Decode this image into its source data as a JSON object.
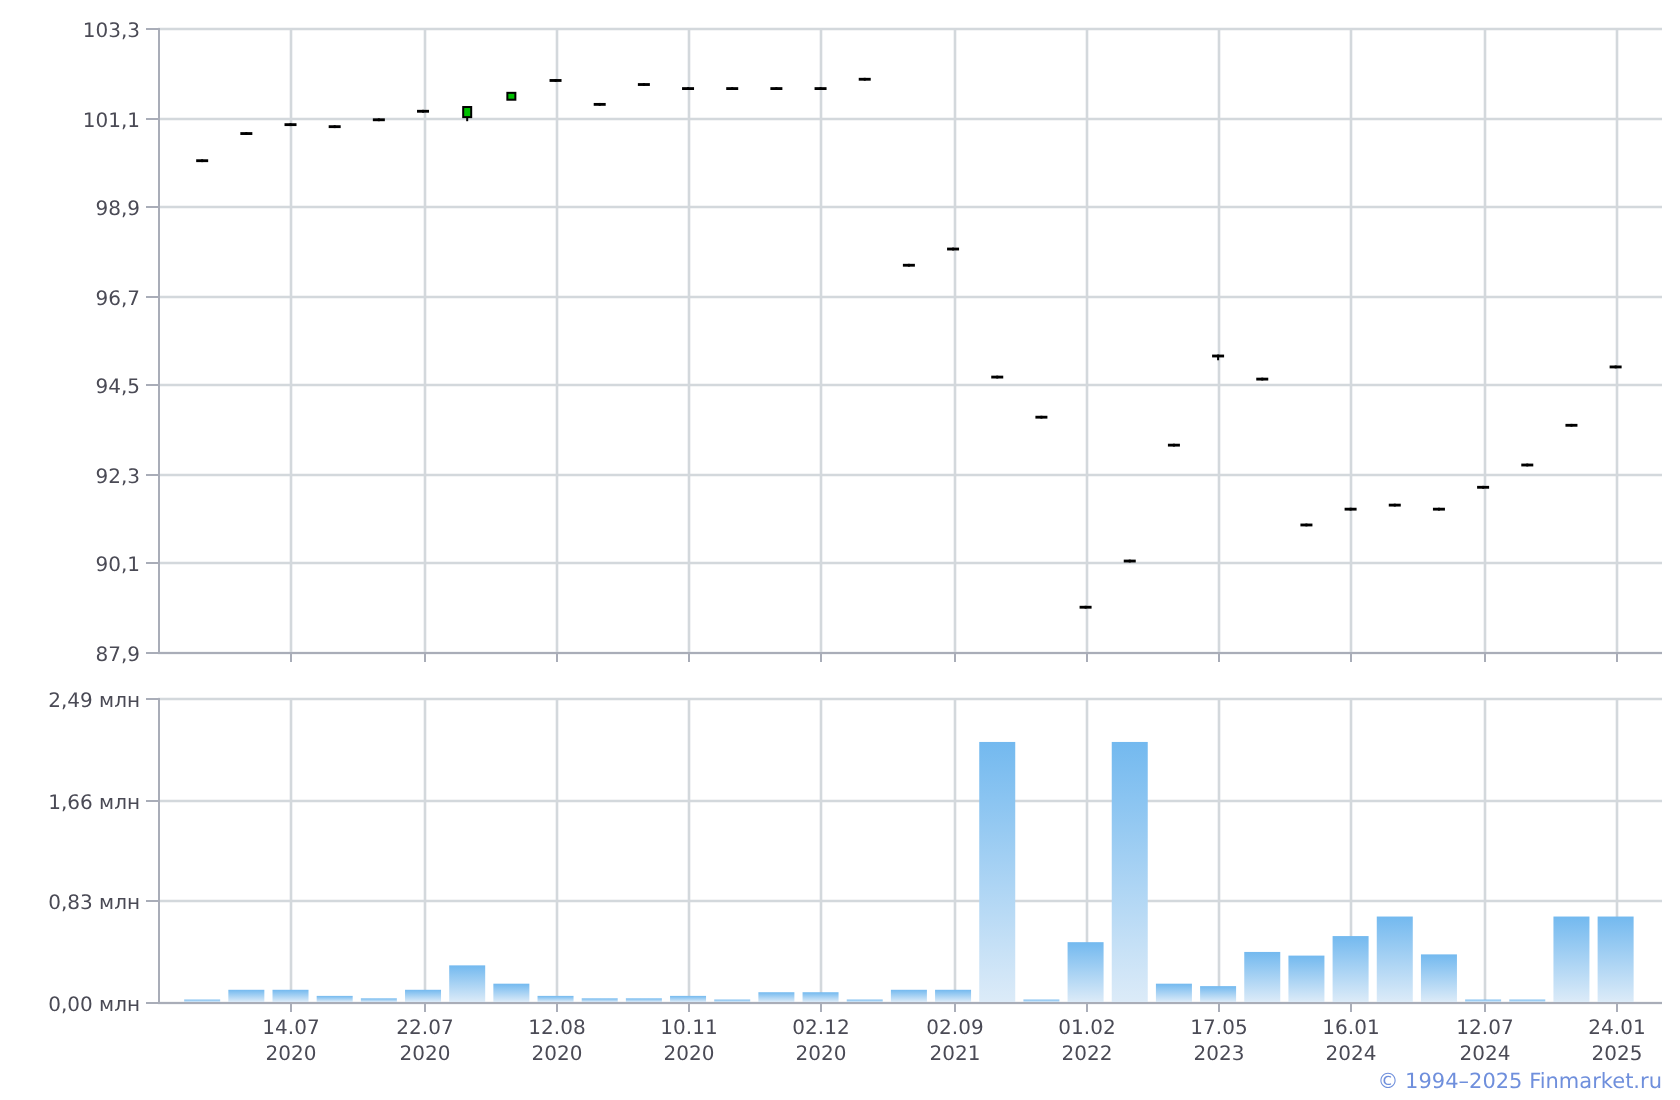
{
  "price_chart": {
    "chart_data": {
      "type": "candlestick",
      "grid": true,
      "ylim": [
        87.9,
        103.3
      ],
      "yticks": [
        {
          "value": 103.3,
          "label": "103,3"
        },
        {
          "value": 101.1,
          "label": "101,1"
        },
        {
          "value": 98.9,
          "label": "98,9"
        },
        {
          "value": 96.7,
          "label": "96,7"
        },
        {
          "value": 94.5,
          "label": "94,5"
        },
        {
          "value": 92.3,
          "label": "92,3"
        },
        {
          "value": 90.1,
          "label": "90,1"
        },
        {
          "value": 87.9,
          "label": "87,9"
        }
      ],
      "ohlc": [
        [
          100.06,
          100.06,
          99.99,
          99.99
        ],
        [
          100.73,
          100.73,
          100.66,
          100.66
        ],
        [
          100.95,
          100.95,
          100.88,
          100.88
        ],
        [
          100.9,
          100.9,
          100.83,
          100.83
        ],
        [
          101.07,
          101.07,
          101.0,
          101.0
        ],
        [
          101.28,
          101.28,
          101.21,
          101.21
        ],
        [
          101.1,
          101.35,
          101.0,
          101.35
        ],
        [
          101.53,
          101.7,
          101.53,
          101.7
        ],
        [
          102.04,
          102.04,
          101.97,
          101.97
        ],
        [
          101.45,
          101.45,
          101.38,
          101.38
        ],
        [
          101.94,
          101.94,
          101.87,
          101.87
        ],
        [
          101.84,
          101.84,
          101.77,
          101.77
        ],
        [
          101.84,
          101.84,
          101.77,
          101.77
        ],
        [
          101.84,
          101.84,
          101.77,
          101.77
        ],
        [
          101.84,
          101.84,
          101.77,
          101.77
        ],
        [
          102.07,
          102.07,
          102.0,
          102.0
        ],
        [
          97.48,
          97.48,
          97.41,
          97.41
        ],
        [
          97.88,
          97.88,
          97.81,
          97.81
        ],
        [
          94.72,
          94.72,
          94.65,
          94.65
        ],
        [
          93.73,
          93.73,
          93.66,
          93.66
        ],
        [
          89.04,
          89.04,
          88.97,
          88.97
        ],
        [
          90.18,
          90.18,
          90.11,
          90.11
        ],
        [
          93.04,
          93.04,
          92.97,
          92.97
        ],
        [
          95.24,
          95.24,
          95.1,
          95.17
        ],
        [
          94.67,
          94.67,
          94.6,
          94.6
        ],
        [
          91.07,
          91.07,
          91.0,
          91.0
        ],
        [
          91.46,
          91.46,
          91.39,
          91.39
        ],
        [
          91.56,
          91.56,
          91.49,
          91.49
        ],
        [
          91.46,
          91.46,
          91.39,
          91.39
        ],
        [
          92.0,
          92.0,
          91.93,
          91.93
        ],
        [
          92.55,
          92.55,
          92.48,
          92.48
        ],
        [
          93.53,
          93.53,
          93.46,
          93.46
        ],
        [
          94.97,
          94.97,
          94.9,
          94.9
        ]
      ]
    }
  },
  "volume_chart": {
    "chart_data": {
      "type": "bar",
      "categories": [
        null,
        null,
        "14.07 2020",
        null,
        null,
        "22.07 2020",
        null,
        null,
        "12.08 2020",
        null,
        null,
        "10.11 2020",
        null,
        null,
        "02.12 2020",
        null,
        null,
        "02.09 2021",
        null,
        null,
        "01.02 2022",
        null,
        null,
        "17.05 2023",
        null,
        null,
        "16.01 2024",
        null,
        null,
        "12.07 2024",
        null,
        null,
        "24.01 2025"
      ],
      "grid": true,
      "ylim": [
        0,
        2.49
      ],
      "yticks": [
        {
          "value": 2.49,
          "label": "2,49 млн"
        },
        {
          "value": 1.66,
          "label": "1,66 млн"
        },
        {
          "value": 0.83,
          "label": "0,83 млн"
        },
        {
          "value": 0,
          "label": "0,00 млн"
        }
      ],
      "series": [
        {
          "color": "#73b9ef",
          "values": [
            0.02,
            0.1,
            0.1,
            0.05,
            0.03,
            0.1,
            0.3,
            0.15,
            0.05,
            0.03,
            0.03,
            0.05,
            0.02,
            0.08,
            0.08,
            0.02,
            0.1,
            0.1,
            2.13,
            0.02,
            0.49,
            2.13,
            0.15,
            0.13,
            0.41,
            0.38,
            0.54,
            0.7,
            0.39,
            0.02,
            0.02,
            0.7,
            0.7
          ]
        }
      ]
    }
  },
  "footer": {
    "copyright": "© 1994–2025 Finmarket.ru"
  }
}
